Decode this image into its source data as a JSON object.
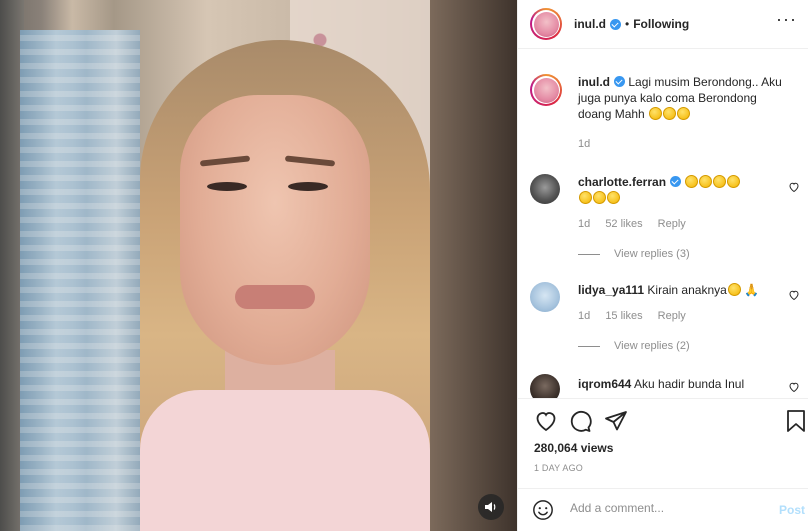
{
  "post": {
    "username": "inul.d",
    "follow_status": "Following",
    "separator": "•"
  },
  "caption": {
    "username": "inul.d",
    "text": "Lagi musim Berondong.. Aku juga punya kalo coma Berondong doang Mahh",
    "emojis": [
      "rofl",
      "rofl",
      "rofl"
    ],
    "time": "1d"
  },
  "comments": [
    {
      "username": "charlotte.ferran",
      "verified": true,
      "text": "",
      "emojis": [
        "rofl",
        "rofl",
        "rofl",
        "rofl",
        "rofl",
        "rofl",
        "rofl"
      ],
      "time": "1d",
      "likes": "52 likes",
      "reply": "Reply",
      "view_replies": "View replies (3)"
    },
    {
      "username": "lidya_ya111",
      "verified": false,
      "text": "Kirain anaknya",
      "emojis": [
        "grin",
        "folded-hands"
      ],
      "time": "1d",
      "likes": "15 likes",
      "reply": "Reply",
      "view_replies": "View replies (2)"
    },
    {
      "username": "iqrom644",
      "verified": false,
      "text": "Aku hadir bunda Inul",
      "emojis": []
    }
  ],
  "stats": {
    "views": "280,064 views",
    "time_ago": "1 DAY AGO"
  },
  "add_comment": {
    "placeholder": "Add a comment...",
    "post_label": "Post"
  },
  "colors": {
    "link_blue": "#3897f0",
    "post_disabled": "#b2dffc",
    "secondary_text": "#8e8e8e",
    "border": "#efefef"
  }
}
